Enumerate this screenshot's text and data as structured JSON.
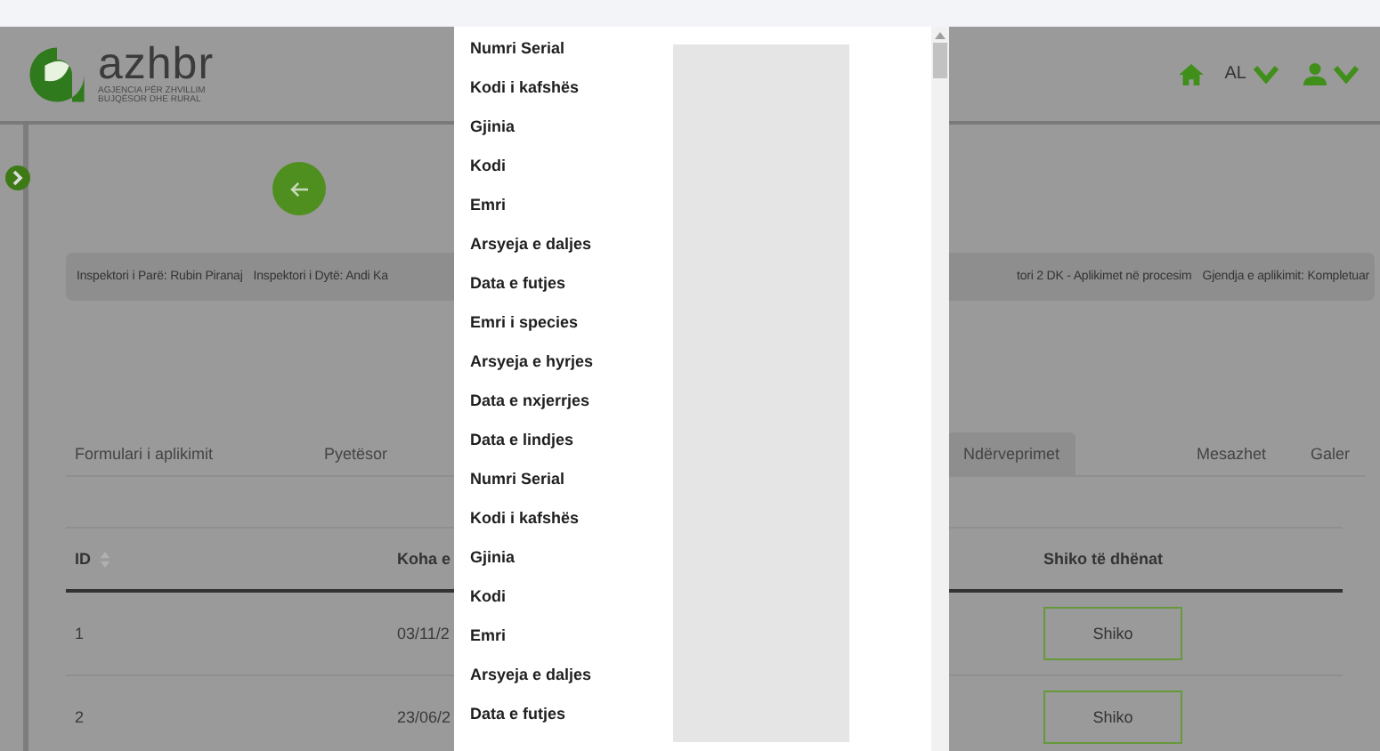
{
  "header": {
    "logo": {
      "name": "azhbr",
      "tagline_1": "AGJENCIA PËR ZHVILLIM",
      "tagline_2": "BUJQËSOR DHE RURAL"
    },
    "language": "AL"
  },
  "info_bar": [
    "Inspektori i Parë: Rubin Piranaj",
    "Inspektori i Dytë: Andi Ka",
    "tori 2 DK - Aplikimet në procesim",
    "Gjendja e aplikimit: Kompletuar"
  ],
  "tabs": [
    {
      "label": "Formulari i aplikimit",
      "selected": false
    },
    {
      "label": "Pyetësor",
      "selected": false
    },
    {
      "label": "Ndërveprimet",
      "selected": true
    },
    {
      "label": "Mesazhet",
      "selected": false
    },
    {
      "label": "Galer",
      "selected": false
    }
  ],
  "table": {
    "columns": [
      "ID",
      "Koha e",
      "Shiko të dhënat"
    ],
    "rows": [
      {
        "id": "1",
        "time": "03/11/2",
        "action": "Shiko"
      },
      {
        "id": "2",
        "time": "23/06/2",
        "action": "Shiko"
      }
    ]
  },
  "dialog": {
    "items": [
      "Numri Serial",
      "Kodi i kafshës",
      "Gjinia",
      "Kodi",
      "Emri",
      "Arsyeja e daljes",
      "Data e futjes",
      "Emri i species",
      "Arsyeja e hyrjes",
      "Data e nxjerrjes",
      "Data e lindjes",
      "Numri Serial",
      "Kodi i kafshës",
      "Gjinia",
      "Kodi",
      "Emri",
      "Arsyeja e daljes",
      "Data e futjes"
    ]
  }
}
